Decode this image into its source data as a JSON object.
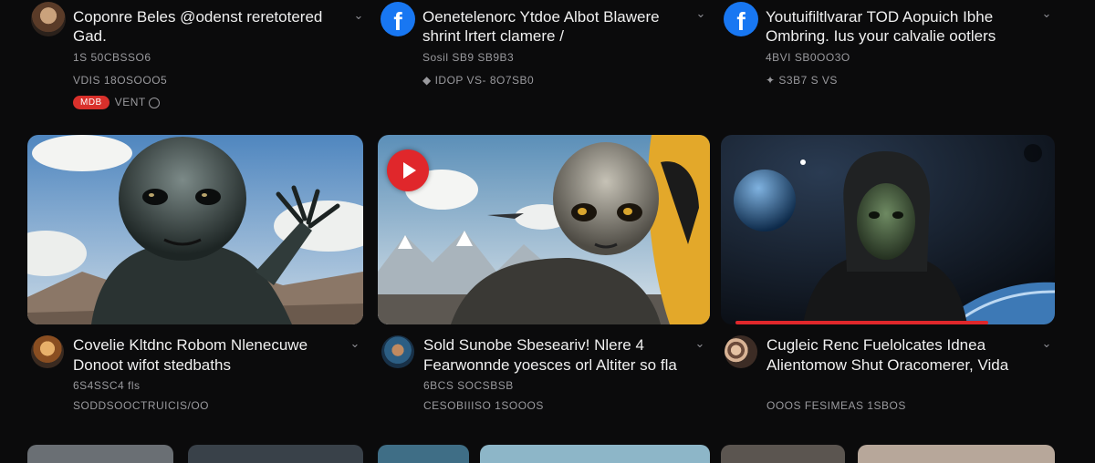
{
  "colors": {
    "background": "#0b0b0c",
    "facebook_blue": "#1877f2",
    "youtube_red": "#e0272b"
  },
  "top_posts": [
    {
      "avatar": "person-avatar",
      "title": "Coponre Beles @odenst reretotered\nGad.",
      "meta1": "1S 50CBSSO6",
      "meta2": "VDIS 18OSOOO5",
      "badge": "MDB",
      "meta3": "VENT"
    },
    {
      "avatar": "facebook-icon",
      "avatar_glyph": "f",
      "title": "Oenetelenorc Ytdoe Albot Blawere\nshrint lrtert clamere /",
      "meta1": "Sosil SB9 SB9B3",
      "meta2": "IDOP   VS- 8O7SB0"
    },
    {
      "avatar": "facebook-icon",
      "avatar_glyph": "f",
      "title": "Youtuifiltlvarar TOD Aopuich Ibhe\nOmbring. Ius your calvalie ootlers",
      "meta1": "4BVI SB0OO3O",
      "meta2": "S3B7  S   VS"
    }
  ],
  "bottom_posts": [
    {
      "avatar": "channel-avatar-a",
      "title": "Covelie Kltdnc Robom Nlenecuwe\nDonoot wifot stedbaths",
      "meta1": "6S4SSC4 fls",
      "meta2": "SODDSOOCTRUICIS/OO"
    },
    {
      "avatar": "channel-avatar-b",
      "title": "Sold Sunobe Sbeseariv! Nlere 4\nFearwonnde yoesces orl Altiter so fla",
      "meta1": "6BCS SOCSBSB",
      "meta2": "CESOBIIISO  1SOOOS"
    },
    {
      "avatar": "channel-avatar-c",
      "title": "Cugleic Renc Fuelolcates Idnea\nAlientomow Shut Oracomerer, Vida",
      "meta1": "OOOS    FESIMEAS 1SBOS",
      "meta2": ""
    }
  ],
  "thumbnails": [
    {
      "subject": "alien-mountains",
      "progress": 0
    },
    {
      "subject": "alien-spaceship",
      "progress": 0
    },
    {
      "subject": "hooded-alien-planet",
      "progress": 0.83
    }
  ]
}
